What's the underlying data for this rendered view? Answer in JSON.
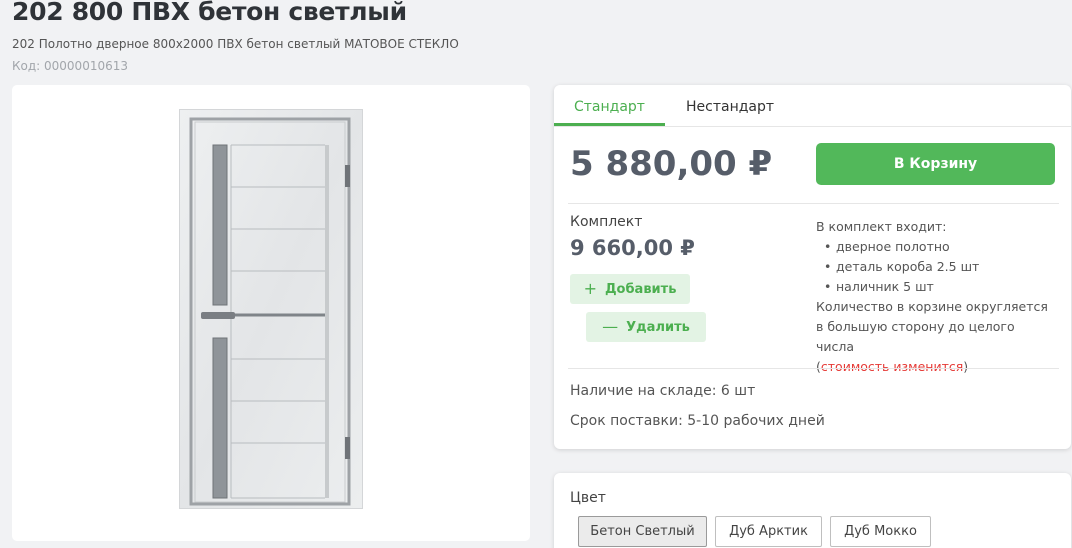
{
  "product": {
    "title": "202 800 ПВХ бетон светлый",
    "subtitle": "202 Полотно дверное 800х2000 ПВХ бетон светлый МАТОВОЕ СТЕКЛО",
    "code": "Код: 00000010613"
  },
  "tabs": [
    {
      "label": "Стандарт",
      "active": true
    },
    {
      "label": "Нестандарт",
      "active": false
    }
  ],
  "price": "5 880,00 ₽",
  "cart_button": "В Корзину",
  "kit": {
    "label": "Комплект",
    "price": "9 660,00 ₽",
    "add_label": "Добавить",
    "remove_label": "Удалить",
    "includes_title": "В комплект входит:",
    "items": [
      "дверное полотно",
      "деталь короба 2.5 шт",
      "наличник 5 шт"
    ],
    "note": "Количество в корзине округляется в большую сторону до целого числа",
    "note_paren_open": "(",
    "note_warning": "стоимость изменится",
    "note_paren_close": ")"
  },
  "stock": "Наличие на складе: 6 шт",
  "delivery": "Срок поставки: 5-10 рабочих дней",
  "colors": {
    "label": "Цвет",
    "options": [
      "Бетон Светлый",
      "Дуб Арктик",
      "Дуб Мокко"
    ],
    "selected": "Бетон Светлый"
  },
  "theme": {
    "accent": "#4caf50",
    "button": "#52b85a",
    "warning": "#e53935"
  },
  "icons": {
    "add": "plus-icon",
    "remove": "minus-icon"
  }
}
